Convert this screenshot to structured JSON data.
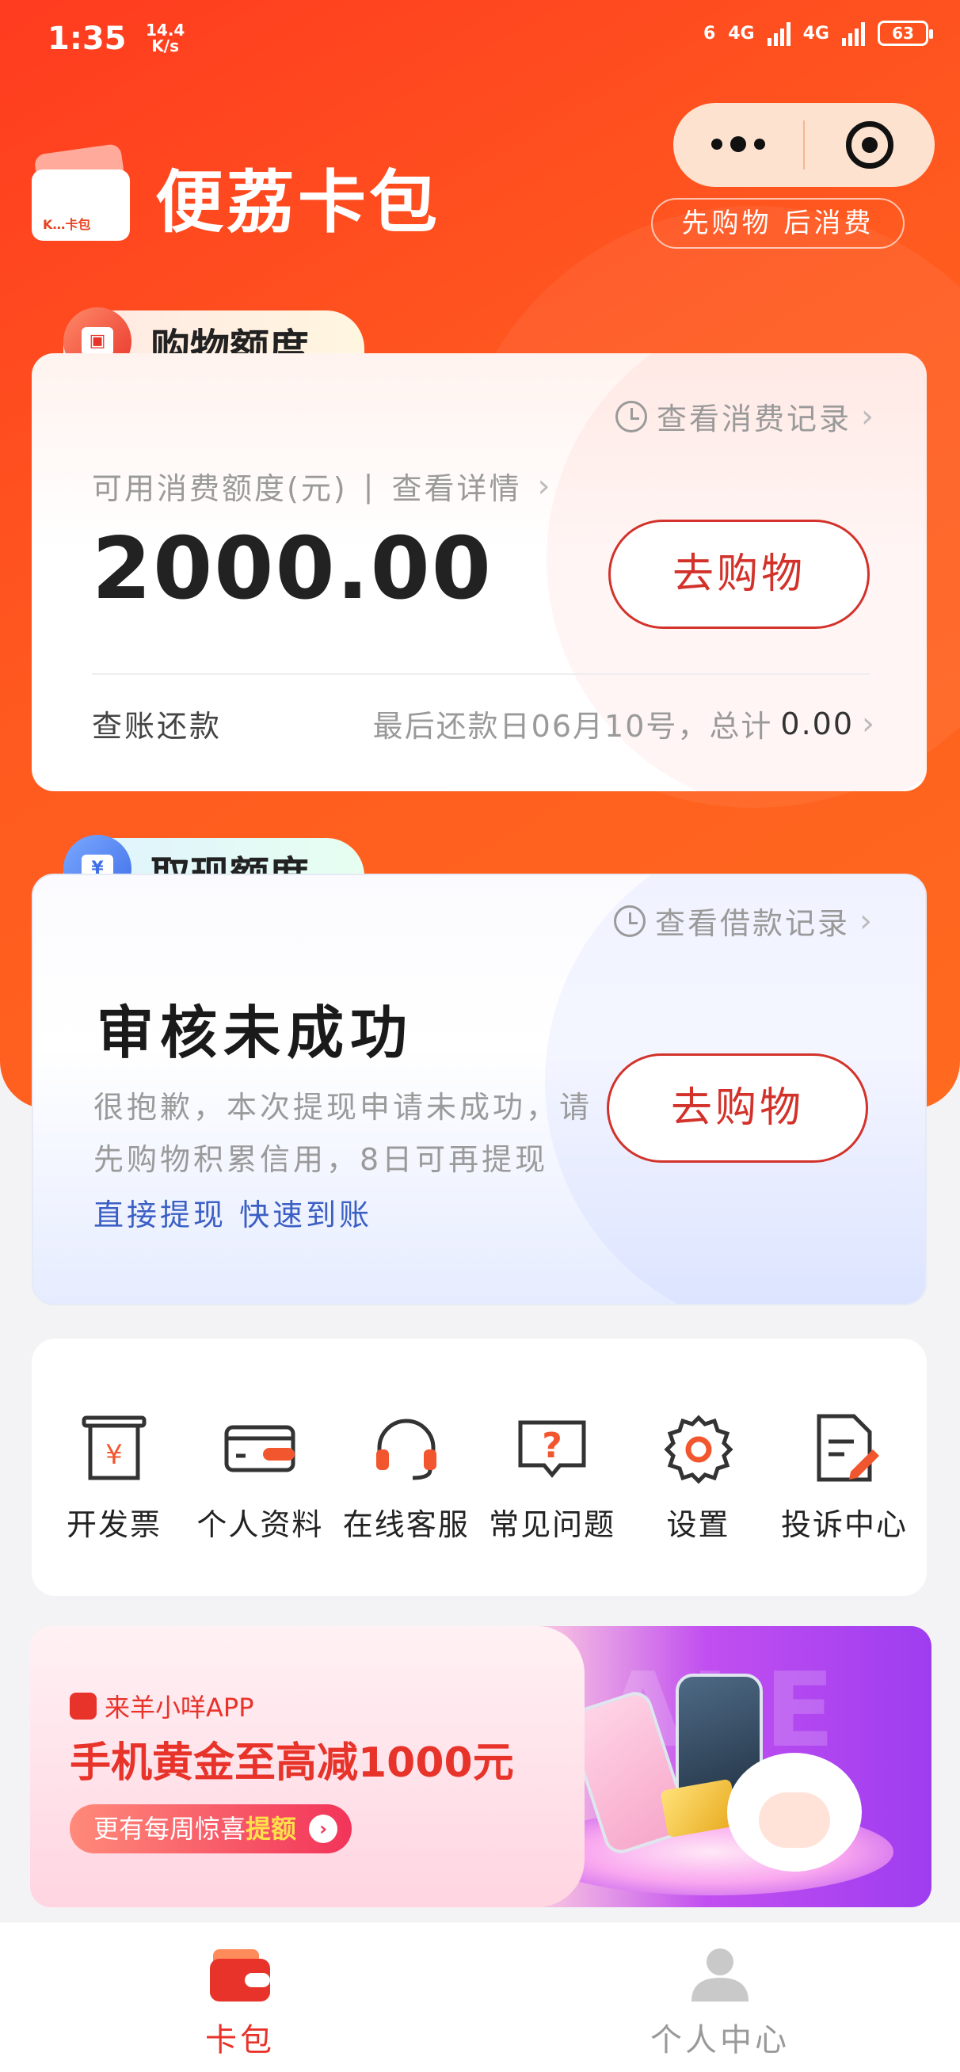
{
  "status_bar": {
    "time": "1:35",
    "net_speed_value": "14.4",
    "net_speed_unit": "K/s",
    "wifi_label": "6",
    "signal1_label": "4G",
    "signal2_label": "4G",
    "battery": "63"
  },
  "header": {
    "brand_name": "便荔卡包",
    "logo_text": "K…卡包",
    "slogan": "先购物 后消费"
  },
  "shopping": {
    "tab_title": "购物额度",
    "record_link": "查看消费记录",
    "available_label": "可用消费额度(元)",
    "separator": "|",
    "detail_link": "查看详情",
    "amount": "2000.00",
    "button": "去购物",
    "repay_label": "查账还款",
    "repay_info": "最后还款日06月10号，总计",
    "repay_total": "0.00"
  },
  "cash": {
    "tab_title": "取现额度",
    "record_link": "查看借款记录",
    "status_title": "审核未成功",
    "description": "很抱歉，本次提现申请未成功，请先购物积累信用，8日可再提现",
    "button": "去购物",
    "quick_link": "直接提现 快速到账"
  },
  "services": [
    {
      "label": "开发票",
      "icon": "invoice-icon"
    },
    {
      "label": "个人资料",
      "icon": "card-icon"
    },
    {
      "label": "在线客服",
      "icon": "headset-icon"
    },
    {
      "label": "常见问题",
      "icon": "question-icon"
    },
    {
      "label": "设置",
      "icon": "gear-icon"
    },
    {
      "label": "投诉中心",
      "icon": "complaint-icon"
    }
  ],
  "banner": {
    "brand": "来羊小咩APP",
    "headline": "手机黄金至高减1000元",
    "pill_text": "更有每周惊喜",
    "pill_highlight": "提额",
    "watermark": "SALE SA"
  },
  "bottom_nav": [
    {
      "label": "卡包",
      "icon": "wallet-icon",
      "active": true
    },
    {
      "label": "个人中心",
      "icon": "person-icon",
      "active": false
    }
  ],
  "colors": {
    "brand_red": "#e8332a",
    "hero_orange": "#ff5a1f",
    "link_blue": "#3b5fc4"
  }
}
